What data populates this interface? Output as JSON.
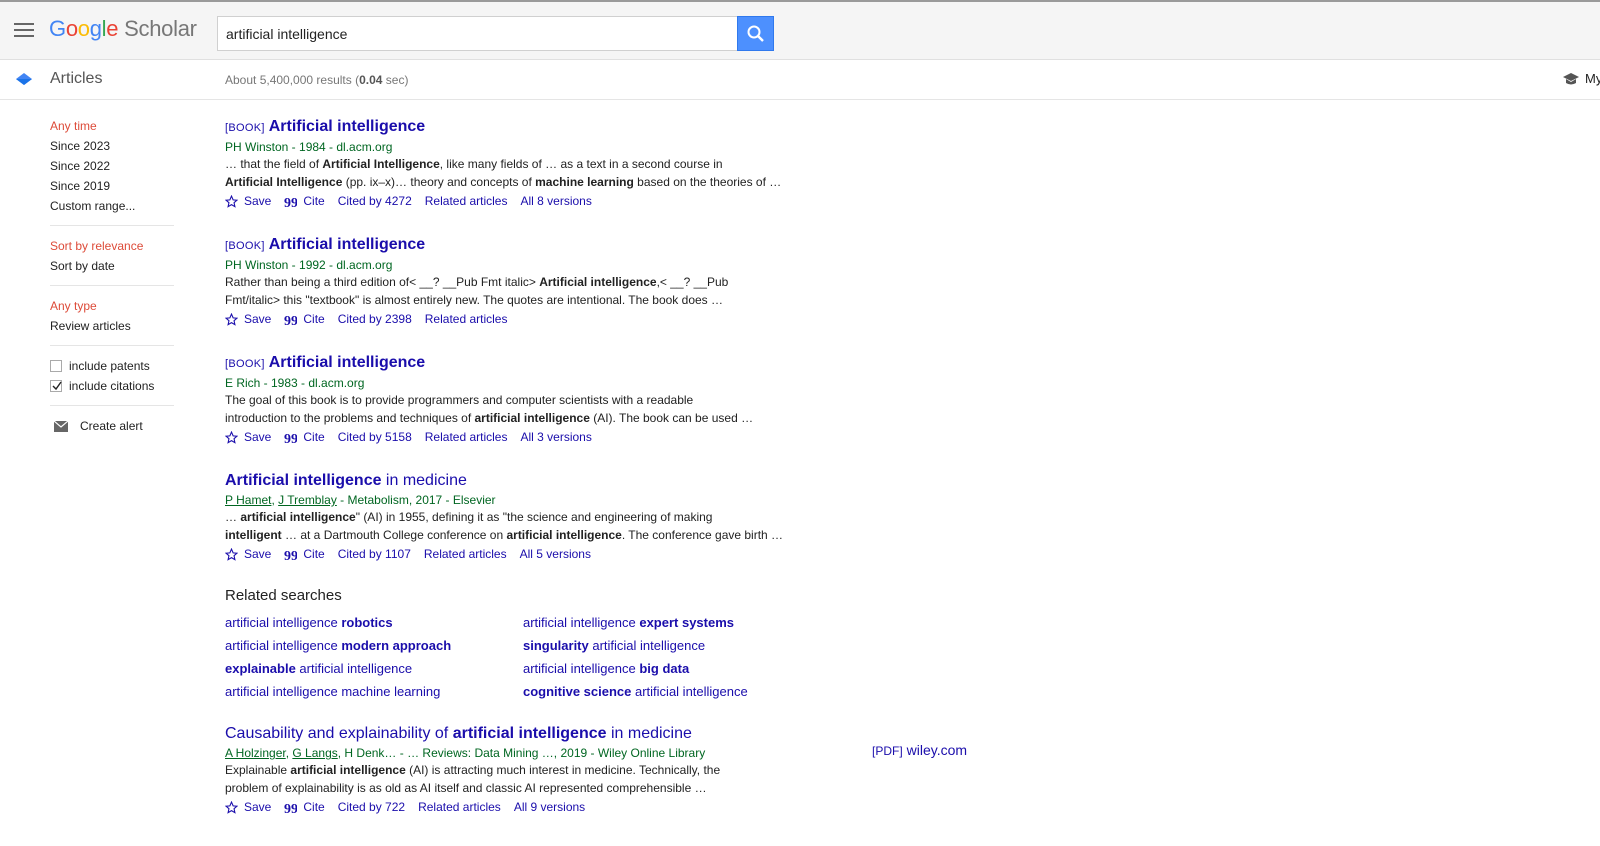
{
  "header": {
    "logo_google": "Google",
    "logo_scholar": "Scholar",
    "search_value": "artificial intelligence"
  },
  "subbar": {
    "section": "Articles",
    "results_prefix": "About 5,400,000 results (",
    "results_time": "0.04",
    "results_suffix": " sec)",
    "my_profile": "My"
  },
  "sidebar": {
    "time": [
      "Any time",
      "Since 2023",
      "Since 2022",
      "Since 2019",
      "Custom range..."
    ],
    "sort": [
      "Sort by relevance",
      "Sort by date"
    ],
    "type": [
      "Any type",
      "Review articles"
    ],
    "include_patents": "include patents",
    "include_citations": "include citations",
    "create_alert": "Create alert"
  },
  "results": [
    {
      "tag": "[BOOK]",
      "title_bold": "Artificial intelligence",
      "title_rest": "",
      "meta": "PH Winston - 1984 - dl.acm.org",
      "snippet_html": "… that the field of <b>Artificial Intelligence</b>, like many fields of … as a text in a second course in<br><b>Artificial Intelligence</b> (pp. ix–x)… theory and concepts of <b>machine learning</b> based on the theories of …",
      "cited": "Cited by 4272",
      "versions": "All 8 versions"
    },
    {
      "tag": "[BOOK]",
      "title_bold": "Artificial intelligence",
      "title_rest": "",
      "meta": "PH Winston - 1992 - dl.acm.org",
      "snippet_html": "Rather than being a third edition of&lt; __? __Pub Fmt italic&gt; <b>Artificial intelligence</b>,&lt; __? __Pub<br>Fmt/italic&gt; this \"textbook\" is almost entirely new. The quotes are intentional. The book does …",
      "cited": "Cited by 2398",
      "versions": ""
    },
    {
      "tag": "[BOOK]",
      "title_bold": "Artificial intelligence",
      "title_rest": "",
      "meta": "E Rich - 1983 - dl.acm.org",
      "snippet_html": "The goal of this book is to provide programmers and computer scientists with a readable<br>introduction to the problems and techniques of <b>artificial intelligence</b> (AI). The book can be used …",
      "cited": "Cited by 5158",
      "versions": "All 3 versions"
    },
    {
      "tag": "",
      "title_bold": "Artificial intelligence",
      "title_rest": " in medicine",
      "meta_html": "<span class=\"au\">P Hamet</span>, <span class=\"au\">J Tremblay</span> - Metabolism, 2017 - Elsevier",
      "snippet_html": "… <b>artificial intelligence</b>\" (AI) in 1955, defining it as \"the science and engineering of making<br><b>intelligent</b> … at a Dartmouth College conference on <b>artificial intelligence</b>. The conference gave birth …",
      "cited": "Cited by 1107",
      "versions": "All 5 versions"
    }
  ],
  "links": {
    "save": "Save",
    "cite": "Cite",
    "related": "Related articles"
  },
  "related_searches": {
    "heading": "Related searches",
    "items_html": [
      "artificial intelligence <b>robotics</b>",
      "artificial intelligence <b>expert systems</b>",
      "artificial intelligence <b>modern approach</b>",
      "<b>singularity</b> artificial intelligence",
      "<b>explainable</b> artificial intelligence",
      "artificial intelligence <b>big data</b>",
      "artificial intelligence machine learning",
      "<b>cognitive science</b> artificial intelligence"
    ]
  },
  "last_result": {
    "title_pre": "Causability and explainability of ",
    "title_bold": "artificial intelligence",
    "title_post": " in medicine",
    "meta_html": "<span class=\"au\">A Holzinger</span>, <span class=\"au\">G Langs</span>, H Denk… - … Reviews: Data Mining …, 2019 - Wiley Online Library",
    "snippet_html": "Explainable <b>artificial intelligence</b> (AI) is attracting much interest in medicine. Technically, the<br>problem of explainability is as old as AI itself and classic AI represented comprehensible …",
    "cited": "Cited by 722",
    "versions": "All 9 versions",
    "pdf_tag": "[PDF]",
    "pdf_source": "wiley.com"
  },
  "colors": {
    "link": "#1a0dab",
    "meta": "#006621",
    "selected": "#dd4b39",
    "search_btn": "#4d90fe"
  }
}
